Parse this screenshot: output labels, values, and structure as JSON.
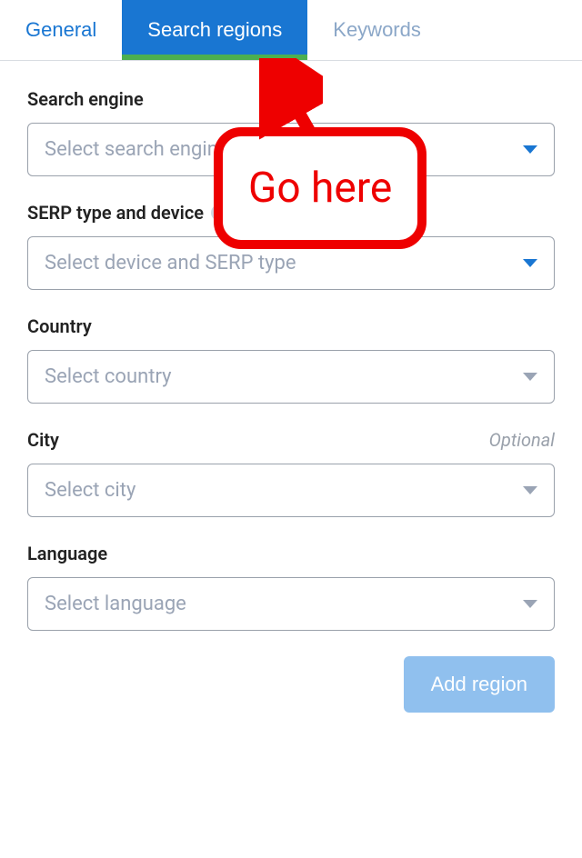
{
  "tabs": {
    "general": "General",
    "search_regions": "Search regions",
    "keywords": "Keywords"
  },
  "fields": {
    "search_engine": {
      "label": "Search engine",
      "placeholder": "Select search engine"
    },
    "serp_type": {
      "label": "SERP type and device",
      "placeholder": "Select device and SERP type"
    },
    "country": {
      "label": "Country",
      "placeholder": "Select country"
    },
    "city": {
      "label": "City",
      "optional": "Optional",
      "placeholder": "Select city"
    },
    "language": {
      "label": "Language",
      "placeholder": "Select language"
    }
  },
  "buttons": {
    "add_region": "Add region"
  },
  "callout": {
    "text": "Go here"
  }
}
